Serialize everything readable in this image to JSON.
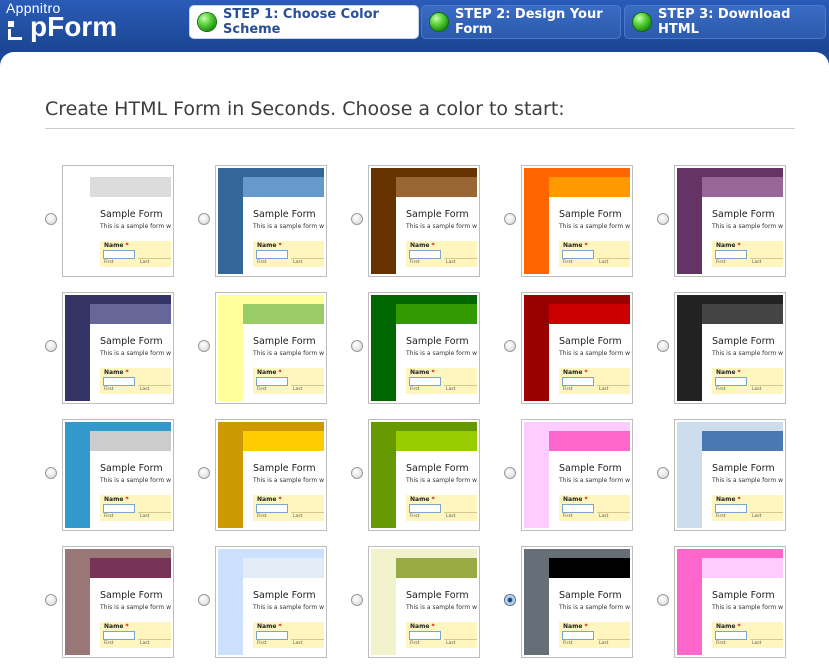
{
  "header": {
    "logo_small": "Appnitro",
    "logo_big": "pForm",
    "steps": [
      {
        "label": "STEP 1: Choose Color Scheme",
        "active": true
      },
      {
        "label": "STEP 2: Design Your Form",
        "active": false
      },
      {
        "label": "STEP 3: Download HTML",
        "active": false
      }
    ]
  },
  "main": {
    "title": "Create HTML Form in Seconds. Choose a color to start:"
  },
  "sample": {
    "title": "Sample Form",
    "description": "This is a sample form wi",
    "field_label": "Name",
    "required": "*",
    "first": "First",
    "last": "Last"
  },
  "themes": [
    {
      "bg": "#ffffff",
      "header": "#dcdcdc",
      "selected": false
    },
    {
      "bg": "#336699",
      "header": "#6699cc",
      "selected": false
    },
    {
      "bg": "#663300",
      "header": "#996633",
      "selected": false
    },
    {
      "bg": "#ff6600",
      "header": "#ff9900",
      "selected": false
    },
    {
      "bg": "#663366",
      "header": "#996699",
      "selected": false
    },
    {
      "bg": "#333366",
      "header": "#666699",
      "selected": false
    },
    {
      "bg": "#ffff99",
      "header": "#99cc66",
      "selected": false
    },
    {
      "bg": "#006600",
      "header": "#339900",
      "selected": false
    },
    {
      "bg": "#990000",
      "header": "#cc0000",
      "selected": false
    },
    {
      "bg": "#222222",
      "header": "#444444",
      "selected": false
    },
    {
      "bg": "#3399cc",
      "header": "#cccccc",
      "selected": false
    },
    {
      "bg": "#cc9900",
      "header": "#ffcc00",
      "selected": false
    },
    {
      "bg": "#669900",
      "header": "#99cc00",
      "selected": false
    },
    {
      "bg": "#ffccff",
      "header": "#ff66cc",
      "selected": false
    },
    {
      "bg": "#ccddee",
      "header": "#4b77b5",
      "selected": false
    },
    {
      "bg": "#997777",
      "header": "#773355",
      "selected": false
    },
    {
      "bg": "#cce0ff",
      "header": "#e4ecf8",
      "selected": false
    },
    {
      "bg": "#f2f2cc",
      "header": "#99aa44",
      "selected": false
    },
    {
      "bg": "#666e77",
      "header": "#000000",
      "selected": true
    },
    {
      "bg": "#ff66cc",
      "header": "#ffccff",
      "selected": false
    }
  ]
}
